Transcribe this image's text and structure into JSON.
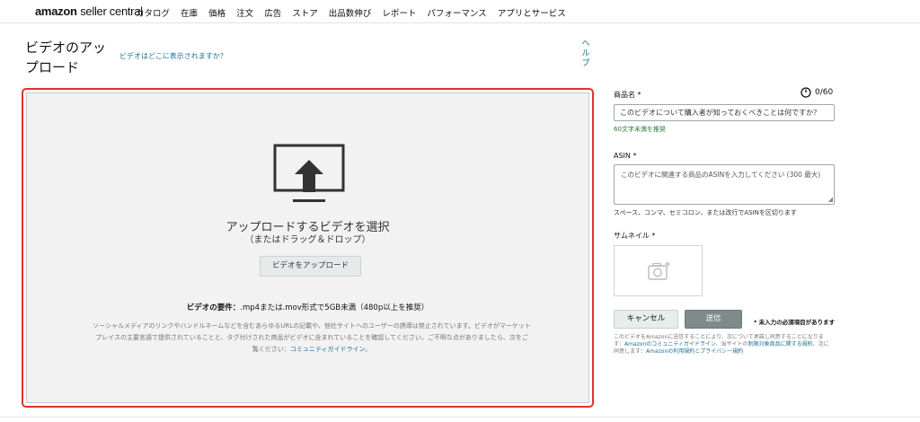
{
  "header": {
    "logo_brand": "amazon",
    "logo_sub": "seller central",
    "nav": [
      "カタログ",
      "在庫",
      "価格",
      "注文",
      "広告",
      "ストア",
      "出品数伸び",
      "レポート",
      "パフォーマンス",
      "アプリとサービス"
    ]
  },
  "page": {
    "title": "ビデオのアップロード",
    "where_link": "ビデオはどこに表示されますか？",
    "help": "ヘルプ"
  },
  "upload": {
    "choose_title": "アップロードするビデオを選択",
    "drag_text": "（またはドラッグ＆ドロップ）",
    "button": "ビデオをアップロード",
    "req_label": "ビデオの要件：",
    "req_text": ".mp4または.mov形式で5GB未満（480p以上を推奨）",
    "disclaimer": "ソーシャルメディアのリンクやハンドルネームなどを含むあらゆるURLの記載や、他社サイトへのユーザーの誘導は禁止されています。ビデオがマーケットプレイスの主要言語で提供されていることと、タグ付けされた商品がビデオに含まれていることを確認してください。ご不明な点がありましたら、次をご覧ください：",
    "disclaimer_link": "コミュニティガイドライン",
    "disclaimer_end": "。"
  },
  "form": {
    "title_label": "商品名 *",
    "title_counter": "0/60",
    "title_placeholder": "このビデオについて購入者が知っておくべきことは何ですか？",
    "title_hint": "60文字未満を推奨",
    "asin_label": "ASIN *",
    "asin_placeholder": "このビデオに関連する商品のASINを入力してください (300 最大)",
    "asin_hint": "スペース、コンマ、セミコロン、または改行でASINを区切ります",
    "thumb_label": "サムネイル *",
    "cancel": "キャンセル",
    "send": "送信",
    "required_note": "* 未入力の必須項目があります",
    "terms_1": "このビデオをAmazonに送信することにより、次について承諾し同意することになります：",
    "terms_link1": "Amazonのコミュニティガイドライン",
    "terms_2": "、当サイトの",
    "terms_link2": "制限対象商品に関する規約",
    "terms_3": "、次に同意します：",
    "terms_link3": "Amazonの利用規約",
    "terms_4": "と",
    "terms_link4": "プライバシー規約",
    "accent_color": "#1a6f96",
    "highlight_color": "#e23030"
  }
}
